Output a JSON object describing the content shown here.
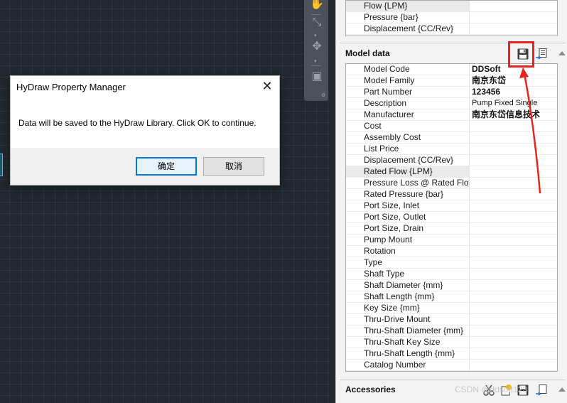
{
  "dialog": {
    "title": "HyDraw Property Manager",
    "close_glyph": "✕",
    "message": "Data will be saved to the HyDraw Library. Click OK to continue.",
    "ok_label": "确定",
    "cancel_label": "取消"
  },
  "top_props": [
    {
      "name": "Flow {LPM}",
      "value": ""
    },
    {
      "name": "Pressure {bar}",
      "value": ""
    },
    {
      "name": "Displacement {CC/Rev}",
      "value": ""
    }
  ],
  "model_data": {
    "header": "Model data",
    "rows": [
      {
        "name": "Model Code",
        "value": "DDSoft"
      },
      {
        "name": "Model Family",
        "value": "南京东岱"
      },
      {
        "name": "Part Number",
        "value": "123456"
      },
      {
        "name": "Description",
        "value": "Pump Fixed Single"
      },
      {
        "name": "Manufacturer",
        "value": "南京东岱信息技术"
      },
      {
        "name": "Cost",
        "value": ""
      },
      {
        "name": "Assembly Cost",
        "value": ""
      },
      {
        "name": "List Price",
        "value": ""
      },
      {
        "name": "Displacement {CC/Rev}",
        "value": ""
      },
      {
        "name": "Rated Flow {LPM}",
        "value": ""
      },
      {
        "name": "Pressure Loss @ Rated Flow",
        "value": ""
      },
      {
        "name": "Rated Pressure {bar}",
        "value": ""
      },
      {
        "name": "Port Size, Inlet",
        "value": ""
      },
      {
        "name": "Port Size, Outlet",
        "value": ""
      },
      {
        "name": "Port Size, Drain",
        "value": ""
      },
      {
        "name": "Pump Mount",
        "value": ""
      },
      {
        "name": "Rotation",
        "value": ""
      },
      {
        "name": "Type",
        "value": ""
      },
      {
        "name": "Shaft Type",
        "value": ""
      },
      {
        "name": "Shaft Diameter {mm}",
        "value": ""
      },
      {
        "name": "Shaft Length {mm}",
        "value": ""
      },
      {
        "name": "Key Size {mm}",
        "value": ""
      },
      {
        "name": "Thru-Drive Mount",
        "value": ""
      },
      {
        "name": "Thru-Shaft Diameter {mm}",
        "value": ""
      },
      {
        "name": "Thru-Shaft Key Size",
        "value": ""
      },
      {
        "name": "Thru-Shaft Length {mm}",
        "value": ""
      },
      {
        "name": "Catalog Number",
        "value": ""
      }
    ]
  },
  "accessories": {
    "header": "Accessories"
  },
  "watermark": "CSDN @ddsoft123",
  "icons": {
    "save": "save-icon",
    "load": "load-from-library-icon",
    "cut": "scissors-icon",
    "add": "add-icon",
    "collapse": "collapse-arrow-icon"
  },
  "colors": {
    "canvas_bg": "#212830",
    "annotation_red": "#e8231c",
    "ok_focus": "#0078d7"
  }
}
